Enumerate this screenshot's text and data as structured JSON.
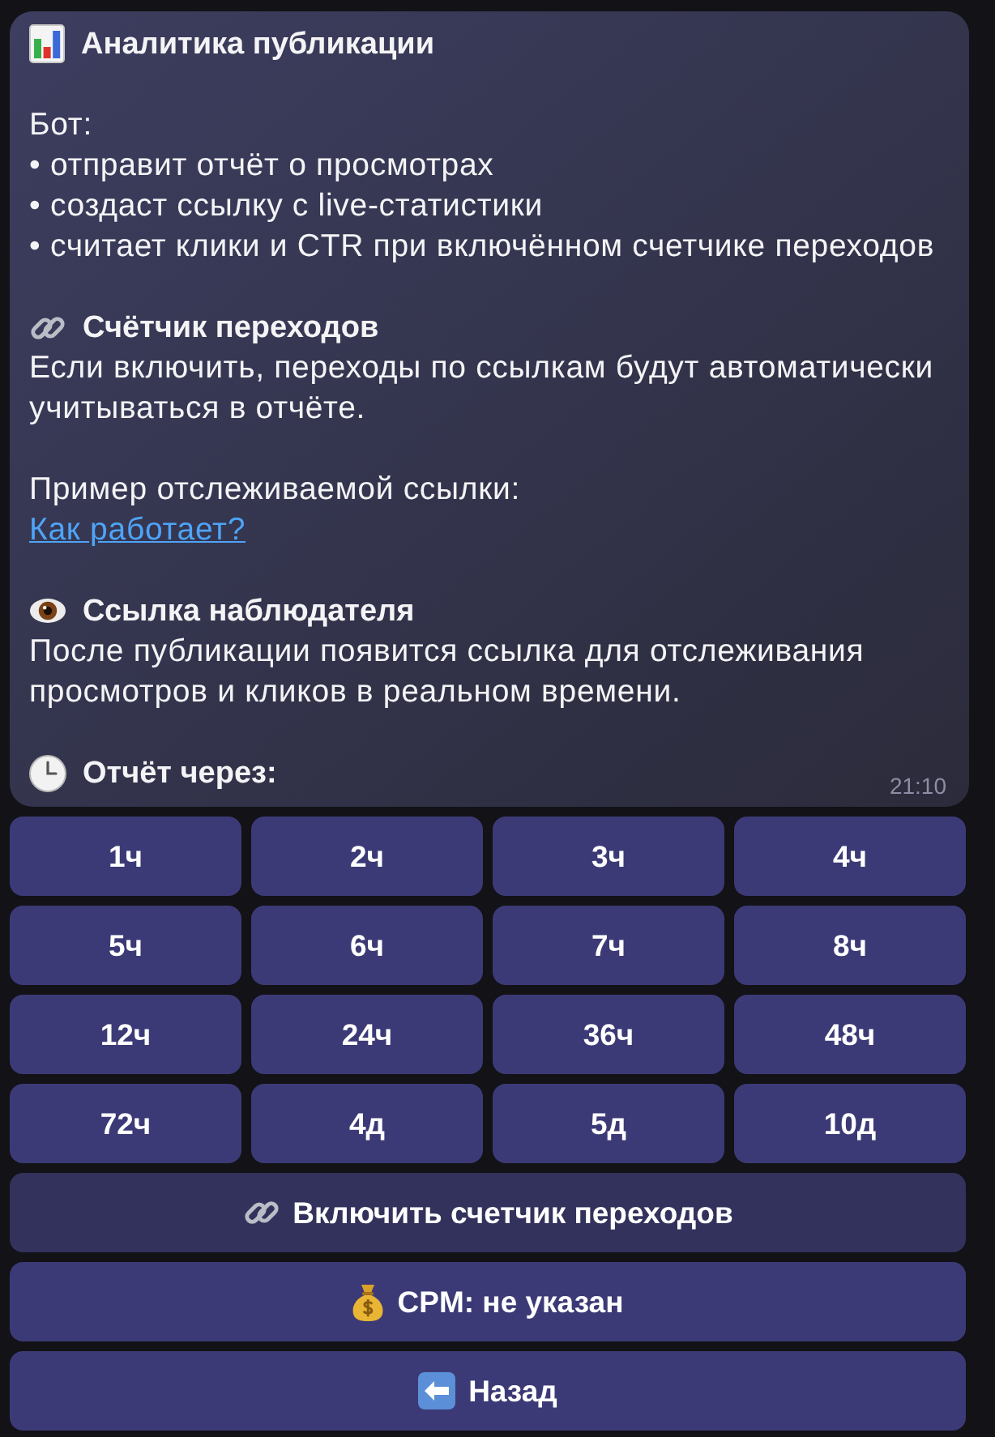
{
  "message": {
    "title": "Аналитика публикации",
    "intro": "Бот:",
    "bullets": [
      "• отправит отчёт о просмотрах",
      "• создаст ссылку с live-статистики",
      "• считает клики и CTR при включённом счетчике переходов"
    ],
    "sections": [
      {
        "kind": "link",
        "heading": "Счётчик переходов",
        "text": "Если включить, переходы по ссылкам будут автоматически учитываться в отчёте."
      },
      {
        "kind": "example",
        "text": "Пример отслеживаемой ссылки:",
        "link": "Как работает?"
      },
      {
        "kind": "eye",
        "heading": "Ссылка наблюдателя",
        "text": "После публикации появится ссылка для отслеживания просмотров и кликов в реальном времени."
      },
      {
        "kind": "clock",
        "heading": "Отчёт через:"
      }
    ],
    "time": "21:10"
  },
  "keyboard": {
    "rows": [
      [
        "1ч",
        "2ч",
        "3ч",
        "4ч"
      ],
      [
        "5ч",
        "6ч",
        "7ч",
        "8ч"
      ],
      [
        "12ч",
        "24ч",
        "36ч",
        "48ч"
      ],
      [
        "72ч",
        "4д",
        "5д",
        "10д"
      ]
    ],
    "actions": [
      {
        "kind": "link",
        "label": "Включить счетчик переходов"
      },
      {
        "kind": "money",
        "label": "CPM: не указан"
      },
      {
        "kind": "back",
        "label": "Назад"
      }
    ]
  }
}
